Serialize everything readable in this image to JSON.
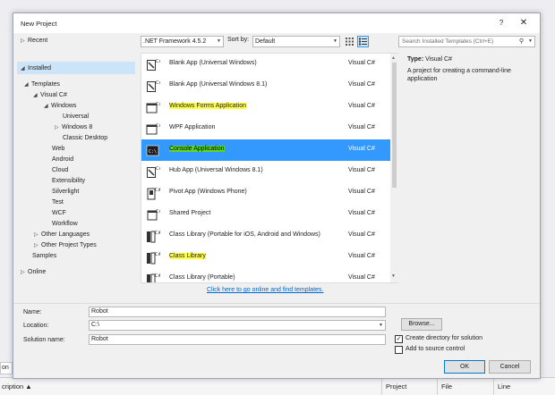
{
  "dialog": {
    "title": "New Project",
    "help_label": "?",
    "close_label": "✕"
  },
  "tree": {
    "recent": "Recent",
    "installed": "Installed",
    "templates": "Templates",
    "visual_csharp": "Visual C#",
    "windows": "Windows",
    "universal": "Universal",
    "windows8": "Windows 8",
    "classic_desktop": "Classic Desktop",
    "web": "Web",
    "android": "Android",
    "cloud": "Cloud",
    "extensibility": "Extensibility",
    "silverlight": "Silverlight",
    "test": "Test",
    "wcf": "WCF",
    "workflow": "Workflow",
    "other_languages": "Other Languages",
    "other_project_types": "Other Project Types",
    "samples": "Samples",
    "online": "Online"
  },
  "toolbar": {
    "framework": ".NET Framework 4.5.2",
    "sort_label": "Sort by:",
    "sort_value": "Default"
  },
  "search": {
    "placeholder": "Search Installed Templates (Ctrl+E)"
  },
  "templates": [
    {
      "name": "Blank App (Universal Windows)",
      "lang": "Visual C#",
      "icon": "universal-app-icon"
    },
    {
      "name": "Blank App (Universal Windows 8.1)",
      "lang": "Visual C#",
      "icon": "universal-app-icon"
    },
    {
      "name": "Windows Forms Application",
      "lang": "Visual C#",
      "icon": "window-form-icon"
    },
    {
      "name": "WPF Application",
      "lang": "Visual C#",
      "icon": "wpf-window-icon"
    },
    {
      "name": "Console Application",
      "lang": "Visual C#",
      "icon": "console-icon"
    },
    {
      "name": "Hub App (Universal Windows 8.1)",
      "lang": "Visual C#",
      "icon": "hub-app-icon"
    },
    {
      "name": "Pivot App (Windows Phone)",
      "lang": "Visual C#",
      "icon": "pivot-app-icon"
    },
    {
      "name": "Shared Project",
      "lang": "Visual C#",
      "icon": "shared-project-icon"
    },
    {
      "name": "Class Library (Portable for iOS, Android and Windows)",
      "lang": "Visual C#",
      "icon": "class-library-icon"
    },
    {
      "name": "Class Library",
      "lang": "Visual C#",
      "icon": "class-library-icon"
    },
    {
      "name": "Class Library (Portable)",
      "lang": "Visual C#",
      "icon": "class-library-icon"
    }
  ],
  "online_link": "Click here to go online and find templates.",
  "description": {
    "type_label": "Type:",
    "type_value": "Visual C#",
    "text": "A project for creating a command-line application"
  },
  "form": {
    "name_label": "Name:",
    "name_value": "Robot",
    "location_label": "Location:",
    "location_value": "C:\\",
    "solution_label": "Solution name:",
    "solution_value": "Robot",
    "browse_label": "Browse...",
    "create_dir_label": "Create directory for solution",
    "source_control_label": "Add to source control",
    "ok_label": "OK",
    "cancel_label": "Cancel"
  },
  "background": {
    "field_fragment": "on",
    "col_description": "cription",
    "col_project": "Project",
    "col_file": "File",
    "col_line": "Line"
  },
  "colors": {
    "selection": "#3399ff",
    "highlight_yellow": "#ffff40",
    "highlight_green": "#5cd82d",
    "link": "#0066cc"
  }
}
